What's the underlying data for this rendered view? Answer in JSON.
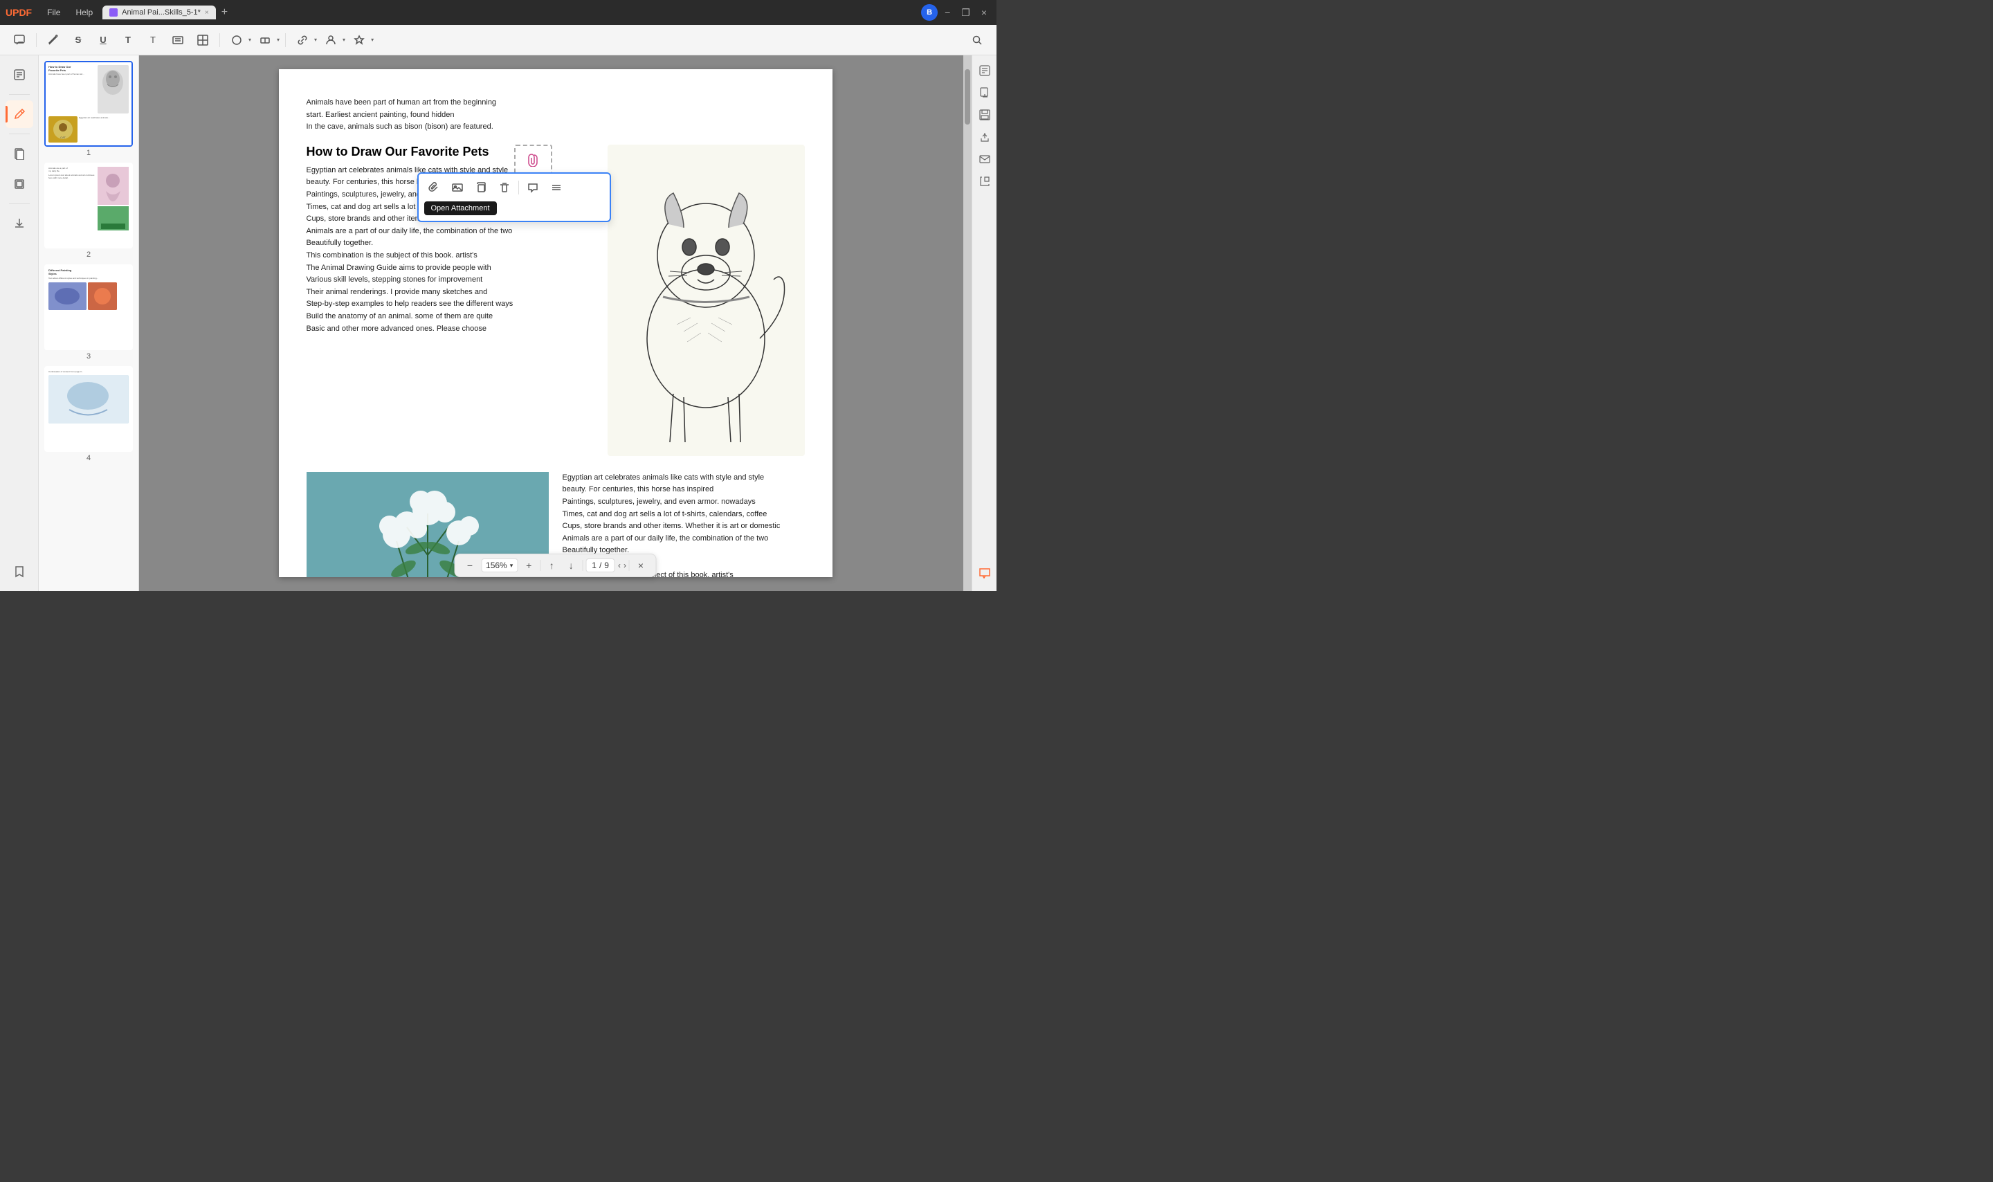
{
  "app": {
    "logo": "UPDF",
    "menu": [
      "File",
      "Help"
    ]
  },
  "tab": {
    "icon_color": "#8b5cf6",
    "title": "Animal Pai...Skills_5-1*",
    "close_label": "×"
  },
  "title_bar_controls": {
    "avatar_letter": "B",
    "minimize": "−",
    "maximize": "❐",
    "close": "×"
  },
  "toolbar": {
    "comment_icon": "💬",
    "pen_icon": "✏",
    "strikethrough_icon": "S",
    "underline_icon": "U",
    "text_icon": "T",
    "text2_icon": "T",
    "text_box_icon": "⬛",
    "table_icon": "⊞",
    "shape_icon": "○",
    "eraser_icon": "◫",
    "link_icon": "🔗",
    "user_icon": "👤",
    "stamp_icon": "▲",
    "search_icon": "🔍"
  },
  "left_sidebar": {
    "icons": [
      {
        "name": "edit-icon",
        "symbol": "✏",
        "active": false
      },
      {
        "name": "divider1",
        "type": "divider"
      },
      {
        "name": "annotate-icon",
        "symbol": "🖊",
        "active": true
      },
      {
        "name": "divider2",
        "type": "divider"
      },
      {
        "name": "pages-icon",
        "symbol": "⬜",
        "active": false
      },
      {
        "name": "layers-icon",
        "symbol": "❑",
        "active": false
      },
      {
        "name": "divider3",
        "type": "divider"
      },
      {
        "name": "export-icon",
        "symbol": "↗",
        "active": false
      },
      {
        "name": "bookmark-icon",
        "symbol": "🔖",
        "active": false
      }
    ]
  },
  "right_sidebar": {
    "icons": [
      {
        "name": "ocr-icon",
        "symbol": "⊞"
      },
      {
        "name": "extract-icon",
        "symbol": "⬇"
      },
      {
        "name": "save-icon",
        "symbol": "💾"
      },
      {
        "name": "share-icon",
        "symbol": "↑"
      },
      {
        "name": "email-icon",
        "symbol": "✉"
      },
      {
        "name": "convert-icon",
        "symbol": "⟳"
      }
    ]
  },
  "thumbnails": [
    {
      "page": 1,
      "selected": true,
      "label": "1"
    },
    {
      "page": 2,
      "selected": false,
      "label": "2"
    },
    {
      "page": 3,
      "selected": false,
      "label": "3"
    },
    {
      "page": 4,
      "selected": false,
      "label": "4"
    }
  ],
  "pdf": {
    "intro_text_lines": [
      "Animals have been part of human art from the beginning",
      "start. Earliest ancient painting, found hidden",
      "In the cave, animals such as bison (bison) are featured."
    ],
    "heading": "How to Draw Our Favorite Pets",
    "body_text": [
      "Egyptian art celebrates animals like cats with style and style",
      "beauty. For centuries, this horse has inspired",
      "Paintings, sculptures, jewelry, and even armor. nowadays",
      "Times, cat and dog art sells a lot of t-shirts, calendars, coffee",
      "Cups, store brands and other items. Whether it is art or domestic",
      "Animals are a part of our daily life, the combination of the two",
      "Beautifully together.",
      "This combination is the subject of this book. artist's",
      "The Animal Drawing Guide aims to provide people with",
      "Various skill levels, stepping stones for improvement",
      "Their animal renderings. I provide many sketches and",
      "Step-by-step examples to help readers see the different ways",
      "Build the anatomy of an animal. some of them are quite",
      "Basic and other more advanced ones. Please choose"
    ],
    "bottom_left_text": [
      "Egyptian art celebrates animals like cats with style and style",
      "beauty. For centuries, this horse has inspired",
      "Paintings, sculptures, jewelry, and even armor. nowadays",
      "Times, cat and dog art sells a lot of t-shirts, calendars, coffee",
      "Cups, store brands and other items. Whether it is art or domestic",
      "Animals are a part of our daily life, the combination of the two",
      "Beautifully together.",
      "",
      "This combination is the subject of this book. artist's"
    ]
  },
  "attachment_popup": {
    "open_label": "Open Attachment",
    "icons": [
      "📎",
      "🖼",
      "⧉",
      "🗑",
      "💬",
      "≡"
    ]
  },
  "bottom_bar": {
    "zoom_out": "−",
    "zoom_in": "+",
    "zoom_value": "156%",
    "zoom_dropdown": "▾",
    "nav_up": "↑",
    "nav_down": "↓",
    "page_current": "1",
    "page_separator": "/",
    "page_total": "9",
    "nav_prev": "‹",
    "nav_next": "›",
    "close": "×"
  },
  "colors": {
    "accent_blue": "#2563eb",
    "accent_orange": "#ff6b35",
    "tab_active_bg": "#e8e8e8",
    "toolbar_bg": "#f5f5f5",
    "sidebar_bg": "#f0f0f0",
    "content_bg": "#888888"
  }
}
